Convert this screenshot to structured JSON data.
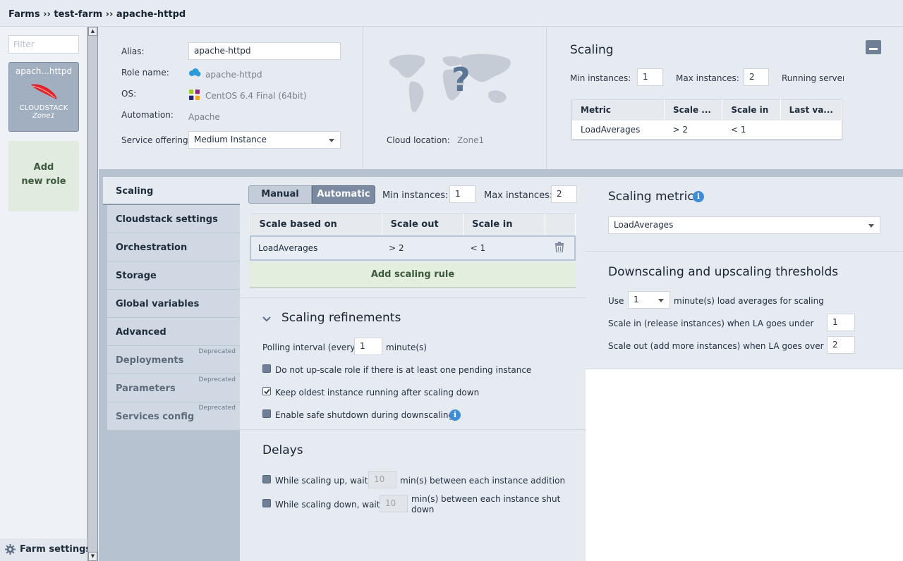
{
  "breadcrumb": "Farms ›› test-farm ›› apache-httpd",
  "sidebar": {
    "filter_placeholder": "Filter",
    "role_card": {
      "name": "apach...httpd",
      "platform": "CLOUDSTACK",
      "zone": "Zone1"
    },
    "add_role_line1": "Add",
    "add_role_line2": "new role",
    "farm_settings": "Farm settings"
  },
  "info": {
    "alias_label": "Alias:",
    "alias_value": "apache-httpd",
    "role_name_label": "Role name:",
    "role_name_value": "apache-httpd",
    "os_label": "OS:",
    "os_value": "CentOS 6.4 Final (64bit)",
    "automation_label": "Automation:",
    "automation_value": "Apache",
    "service_offering_label": "Service offering:",
    "service_offering_value": "Medium Instance",
    "cloud_location_label": "Cloud location:",
    "cloud_location_value": "Zone1",
    "map_unknown": "?"
  },
  "scaling_summary": {
    "title": "Scaling",
    "min_label": "Min instances:",
    "min_value": "1",
    "max_label": "Max instances:",
    "max_value": "2",
    "running_label": "Running servers",
    "columns": [
      "Metric",
      "Scale ...",
      "Scale in",
      "Last va..."
    ],
    "rows": [
      [
        "LoadAverages",
        "> 2",
        "< 1",
        ""
      ]
    ]
  },
  "tabs": [
    {
      "label": "Scaling",
      "active": true
    },
    {
      "label": "Cloudstack settings"
    },
    {
      "label": "Orchestration"
    },
    {
      "label": "Storage"
    },
    {
      "label": "Global variables"
    },
    {
      "label": "Advanced"
    },
    {
      "label": "Deployments",
      "deprecated": "Deprecated"
    },
    {
      "label": "Parameters",
      "deprecated": "Deprecated"
    },
    {
      "label": "Services config",
      "deprecated": "Deprecated"
    }
  ],
  "scaling": {
    "manual_label": "Manual",
    "automatic_label": "Automatic",
    "min_label": "Min instances:",
    "min_value": "1",
    "max_label": "Max instances:",
    "max_value": "2",
    "rule_columns": [
      "Scale based on",
      "Scale out",
      "Scale in"
    ],
    "rule_rows": [
      [
        "LoadAverages",
        "> 2",
        "< 1"
      ]
    ],
    "add_rule_label": "Add scaling rule"
  },
  "refinements": {
    "title": "Scaling refinements",
    "polling_label": "Polling interval (every)",
    "polling_value": "1",
    "polling_unit": "minute(s)",
    "cb_no_upscale": "Do not up-scale role if there is at least one pending instance",
    "cb_keep_oldest": "Keep oldest instance running after scaling down",
    "cb_safe_shutdown": "Enable safe shutdown during downscaling"
  },
  "delays": {
    "title": "Delays",
    "up_label": "While scaling up, wait",
    "up_value": "10",
    "up_suffix": "min(s) between each instance addition",
    "down_label": "While scaling down, wait",
    "down_value": "10",
    "down_suffix_1": "min(s) between each instance shut",
    "down_suffix_2": "down"
  },
  "metric": {
    "title": "Scaling metric",
    "selected": "LoadAverages"
  },
  "thresholds": {
    "title": "Downscaling and upscaling thresholds",
    "use_label": "Use",
    "use_value": "1",
    "use_suffix": "minute(s) load averages for scaling",
    "scale_in_label": "Scale in (release instances) when LA goes under",
    "scale_in_value": "1",
    "scale_out_label": "Scale out (add more instances) when LA goes over",
    "scale_out_value": "2"
  },
  "colors": {
    "accent": "#7b8aa1",
    "info": "#3d8ed6",
    "add": "#e3eedf"
  }
}
